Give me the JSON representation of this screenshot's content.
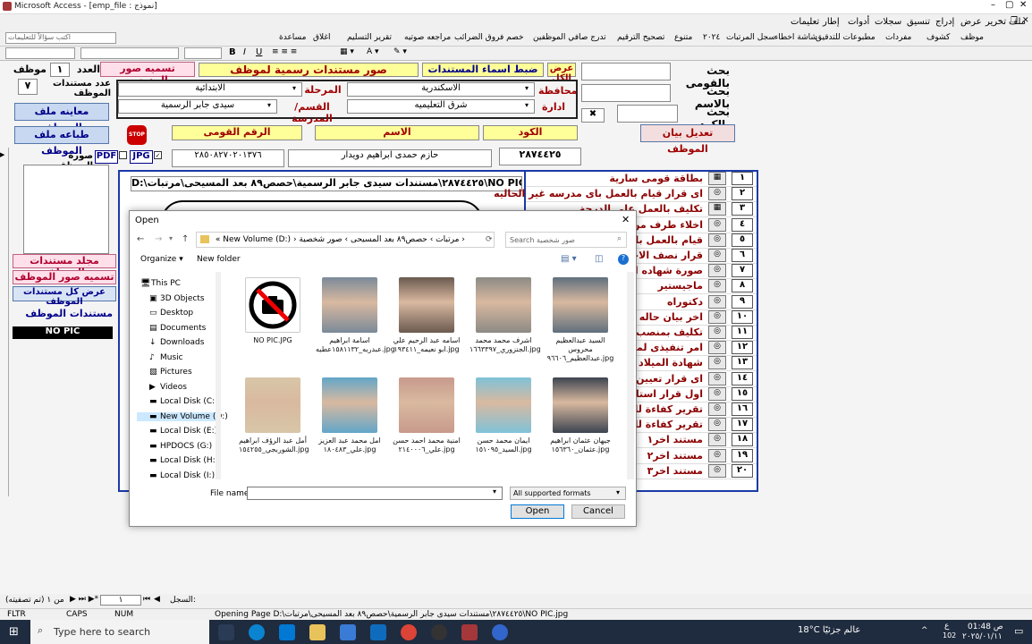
{
  "window": {
    "title": "Microsoft Access - [emp_file : نموذج]"
  },
  "menu": [
    "ملف",
    "تحرير",
    "عرض",
    "إدراج",
    "تنسيق",
    "سجلات",
    "أدوات",
    "إطار",
    "تعليمات"
  ],
  "toolbar": {
    "help_placeholder": "اكتب سؤالاً للتعليمات",
    "items": [
      "موظف",
      "كشوف",
      "مفردات",
      "مطبوعات للتدقيق",
      "شاشة اخطاء",
      "سجل المرتبات",
      "٢٠٢٤",
      "متنوع",
      "تصحيح الترقيم",
      "تدرج صافي الموظفين",
      "خصم فروق الضرائب",
      "مراجعه صوتيه",
      "تقرير التسليم",
      "اغلاق",
      "مساعدة"
    ]
  },
  "form": {
    "search_national_label": "بحث بالقومى",
    "search_name_label": "بحث بالاسم",
    "search_code_label": "بحث بالكود",
    "show_all_label": "عرض الكل",
    "adjust_names_label": "ضبط اسماء المستندات",
    "official_docs_label": "صور مستندات رسمية لموظف",
    "school_images_label": "تسميه صور المدرسه",
    "count_label": "العدد",
    "count_value": "١",
    "employee_label": "موظف",
    "docs_count_label": "عدد مستندات الموظف",
    "docs_count_value": "٧",
    "governorate_label": "محافظة",
    "governorate_value": "الاسكندرية",
    "directorate_label": "ادارة",
    "directorate_value": "شرق التعليميه",
    "stage_label": "المرحلة",
    "stage_value": "الابتدائية",
    "section_label": "القسم/المدرسة",
    "section_value": "سيدى جابر الرسمية",
    "preview_file_label": "معاينه ملف الموظف",
    "print_file_label": "طباعه ملف الموظف",
    "edit_employee_label": "تعديل بيان الموظف",
    "stop_label": "STOP",
    "code_header": "الكود",
    "name_header": "الاسم",
    "national_header": "الرقم القومى",
    "code_value": "٢٨٧٤٤٢٥",
    "name_value": "حازم حمدى ابراهيم دويدار",
    "national_value": "٢٨٥٠٨٢٧٠٢٠١٣٧٦",
    "pdf_label": "PDF",
    "jpg_label": "JPG",
    "employee_photo_label": "صورة الموظف",
    "path_value": "D:\\٢٨٧٤٤٢٥\\مستندات سيدى جابر الرسمية\\حصص٨٩ بعد المسيحى\\مرتبات\\NO PIC.jpg",
    "folder_label": "مجلد مستندات الموظف",
    "name_photos_label": "تسميه صور الموظف",
    "show_all_docs_label": "عرض كل مستندات الموظف",
    "employee_docs_label": "مستندات الموظف",
    "no_pic_label": "NO PIC"
  },
  "doc_list": [
    {
      "n": "١",
      "label": "بطاقة قومى سارية"
    },
    {
      "n": "٢",
      "label": "اى قرار قيام بالعمل باى مدرسه غير الحاليه"
    },
    {
      "n": "٣",
      "label": "تكليف بالعمل على الدرجة"
    },
    {
      "n": "٤",
      "label": "اخلاء طرف من المدرسة"
    },
    {
      "n": "٥",
      "label": "قيام بالعمل بالمدرسة"
    },
    {
      "n": "٦",
      "label": "قرار نصف الاجر"
    },
    {
      "n": "٧",
      "label": "صورة شهاده المؤهل"
    },
    {
      "n": "٨",
      "label": "ماجيستير"
    },
    {
      "n": "٩",
      "label": "دكتوراه"
    },
    {
      "n": "١٠",
      "label": "اخر بيان حاله وظيفية"
    },
    {
      "n": "١١",
      "label": "تكليف بمنصب"
    },
    {
      "n": "١٢",
      "label": "امر تنفيذى لمنصب"
    },
    {
      "n": "١٣",
      "label": "شهادة الميلاد"
    },
    {
      "n": "١٤",
      "label": "اى قرار تعيين او ترقية"
    },
    {
      "n": "١٥",
      "label": "اول قرار استلام العمل"
    },
    {
      "n": "١٦",
      "label": "تقرير كفاءة للعام"
    },
    {
      "n": "١٧",
      "label": "تقرير كفاءة للعام"
    },
    {
      "n": "١٨",
      "label": "مستند اخر١"
    },
    {
      "n": "١٩",
      "label": "مستند اخر٢"
    },
    {
      "n": "٢٠",
      "label": "مستند اخر٣"
    }
  ],
  "dialog": {
    "title": "Open",
    "breadcrumb": [
      "New Volume (D:)",
      "مرتبات",
      "حصص٨٩ بعد المسيحى",
      "صور شخصية"
    ],
    "search_placeholder": "Search صور شخصية",
    "organize_label": "Organize",
    "new_folder_label": "New folder",
    "nav_items": [
      "This PC",
      "3D Objects",
      "Desktop",
      "Documents",
      "Downloads",
      "Music",
      "Pictures",
      "Videos",
      "Local Disk (C:)",
      "New Volume (D:)",
      "Local Disk (E:)",
      "HPDOCS (G:)",
      "Local Disk (H:)",
      "Local Disk (I:)"
    ],
    "files": [
      {
        "name": "NO PIC.JPG",
        "icon": "no-camera-icon"
      },
      {
        "name": "اسامة ابراهيم عبدربه_١٥٨١١٣٢عطيه.jpg",
        "icon": "person-photo"
      },
      {
        "name": "اسامه عبد الرحيم علي ابو نعيمه_١٩٣٤١١.jpg",
        "icon": "person-photo"
      },
      {
        "name": "اشرف محمد محمد الجنزوري_١٦٦٣٣٩٧.jpg",
        "icon": "person-photo"
      },
      {
        "name": "السيد عبدالعظيم محروس عبدالعظيم_٩٦٦٠٦.jpg",
        "icon": "person-photo"
      },
      {
        "name": "أمل عبد الرؤف ابراهيم الشوربجي_١٥٤٢٥٥.jpg",
        "icon": "person-photo"
      },
      {
        "name": "امل محمد عبد العزيز علي_١٨٠٤٨٣.jpg",
        "icon": "person-photo"
      },
      {
        "name": "امنية محمد احمد حسن علي_٢١٤٠٠٠٦.jpg",
        "icon": "person-photo"
      },
      {
        "name": "ايمان محمد حسن السيد_١٥١٠٩٥.jpg",
        "icon": "person-photo"
      },
      {
        "name": "جيهان عثمان ابراهيم عثمان_١٥٦٣٦٠.jpg",
        "icon": "person-photo"
      }
    ],
    "file_name_label": "File name:",
    "file_type_value": "All supported formats",
    "open_label": "Open",
    "cancel_label": "Cancel"
  },
  "statusbar": {
    "record_label": "السجل:",
    "record_value": "١",
    "of_label": "من ١ (تم تصفيته)",
    "message": "Opening Page D:\\٢٨٧٤٤٢٥\\مستندات سيدى جابر الرسمية\\حصص٨٩ بعد المسيحى\\مرتبات\\NO PIC.jpg",
    "fltr": "FLTR",
    "caps": "CAPS",
    "num": "NUM"
  },
  "taskbar": {
    "search_placeholder": "Type here to search",
    "weather": "18°C عالم جزئيًا",
    "time": "01:48 ص",
    "date": "٢٠٢٥/٠١/١١",
    "lang": "ع",
    "badge": "102"
  },
  "colors": {
    "accent_red": "#a00000",
    "list_border": "#1a3aa8",
    "yellow": "#ffff99",
    "taskbar": "#1f2b3e"
  }
}
